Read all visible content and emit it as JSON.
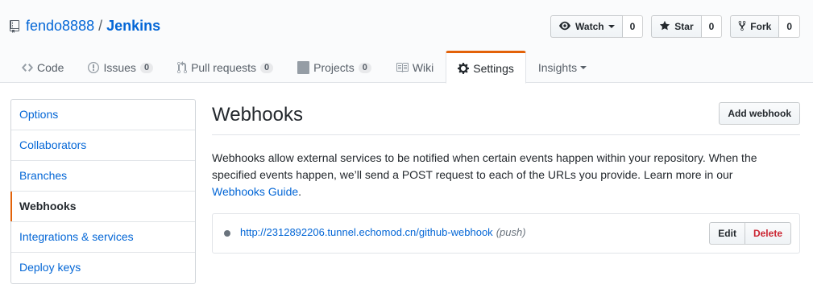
{
  "repo": {
    "owner": "fendo8888",
    "separator": "/",
    "name": "Jenkins"
  },
  "actions": [
    {
      "label": "Watch",
      "count": "0",
      "icon": "eye-icon"
    },
    {
      "label": "Star",
      "count": "0",
      "icon": "star-icon"
    },
    {
      "label": "Fork",
      "count": "0",
      "icon": "fork-icon"
    }
  ],
  "tabs": [
    {
      "label": "Code",
      "icon": "code-icon"
    },
    {
      "label": "Issues",
      "count": "0",
      "icon": "issue-icon"
    },
    {
      "label": "Pull requests",
      "count": "0",
      "icon": "pull-request-icon"
    },
    {
      "label": "Projects",
      "count": "0",
      "icon": "project-icon"
    },
    {
      "label": "Wiki",
      "icon": "book-icon"
    },
    {
      "label": "Settings",
      "icon": "gear-icon",
      "selected": true
    },
    {
      "label": "Insights",
      "icon": "caret-down-icon"
    }
  ],
  "sidebar": {
    "items": [
      {
        "label": "Options"
      },
      {
        "label": "Collaborators"
      },
      {
        "label": "Branches"
      },
      {
        "label": "Webhooks",
        "selected": true
      },
      {
        "label": "Integrations & services"
      },
      {
        "label": "Deploy keys"
      }
    ]
  },
  "main": {
    "title": "Webhooks",
    "add_button": "Add webhook",
    "description": "Webhooks allow external services to be notified when certain events happen within your repository. When the specified events happen, we’ll send a POST request to each of the URLs you provide. Learn more in our",
    "guide_link": "Webhooks Guide",
    "description_end": "."
  },
  "hooks": [
    {
      "url": "http://2312892206.tunnel.echomod.cn/github-webhook",
      "events": "(push)",
      "edit_label": "Edit",
      "delete_label": "Delete"
    }
  ],
  "colors": {
    "accent": "#e36209",
    "link": "#0366d6",
    "danger": "#cb2431"
  }
}
